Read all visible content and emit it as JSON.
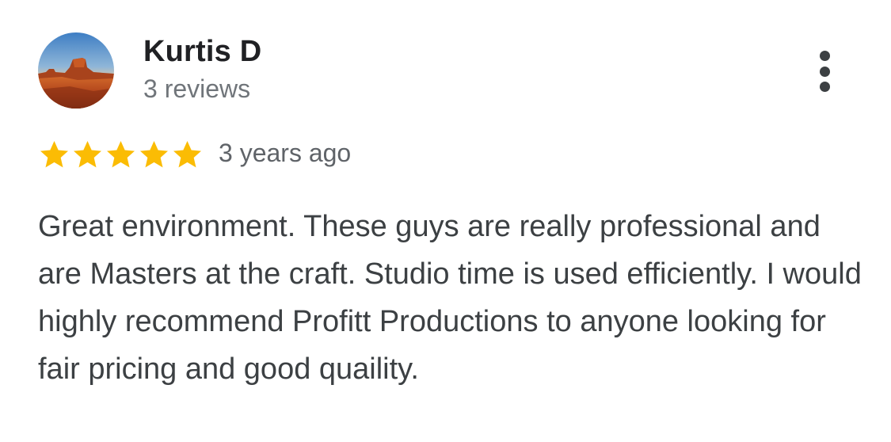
{
  "reviewer": {
    "name": "Kurtis D",
    "review_count": "3 reviews",
    "avatar_icon": "desert-mesa-photo"
  },
  "menu": {
    "icon": "more-vertical-icon"
  },
  "rating": {
    "stars": 5,
    "max": 5,
    "star_color": "#FBBC04",
    "date": "3 years ago"
  },
  "review": {
    "text": "Great environment. These guys are really professional and are Masters at the craft. Studio time is used efficiently. I would highly recommend Profitt Productions to anyone looking for fair pricing and good quaility."
  },
  "colors": {
    "name": "#202124",
    "secondary": "#70757a",
    "body_text": "#3c4043"
  }
}
